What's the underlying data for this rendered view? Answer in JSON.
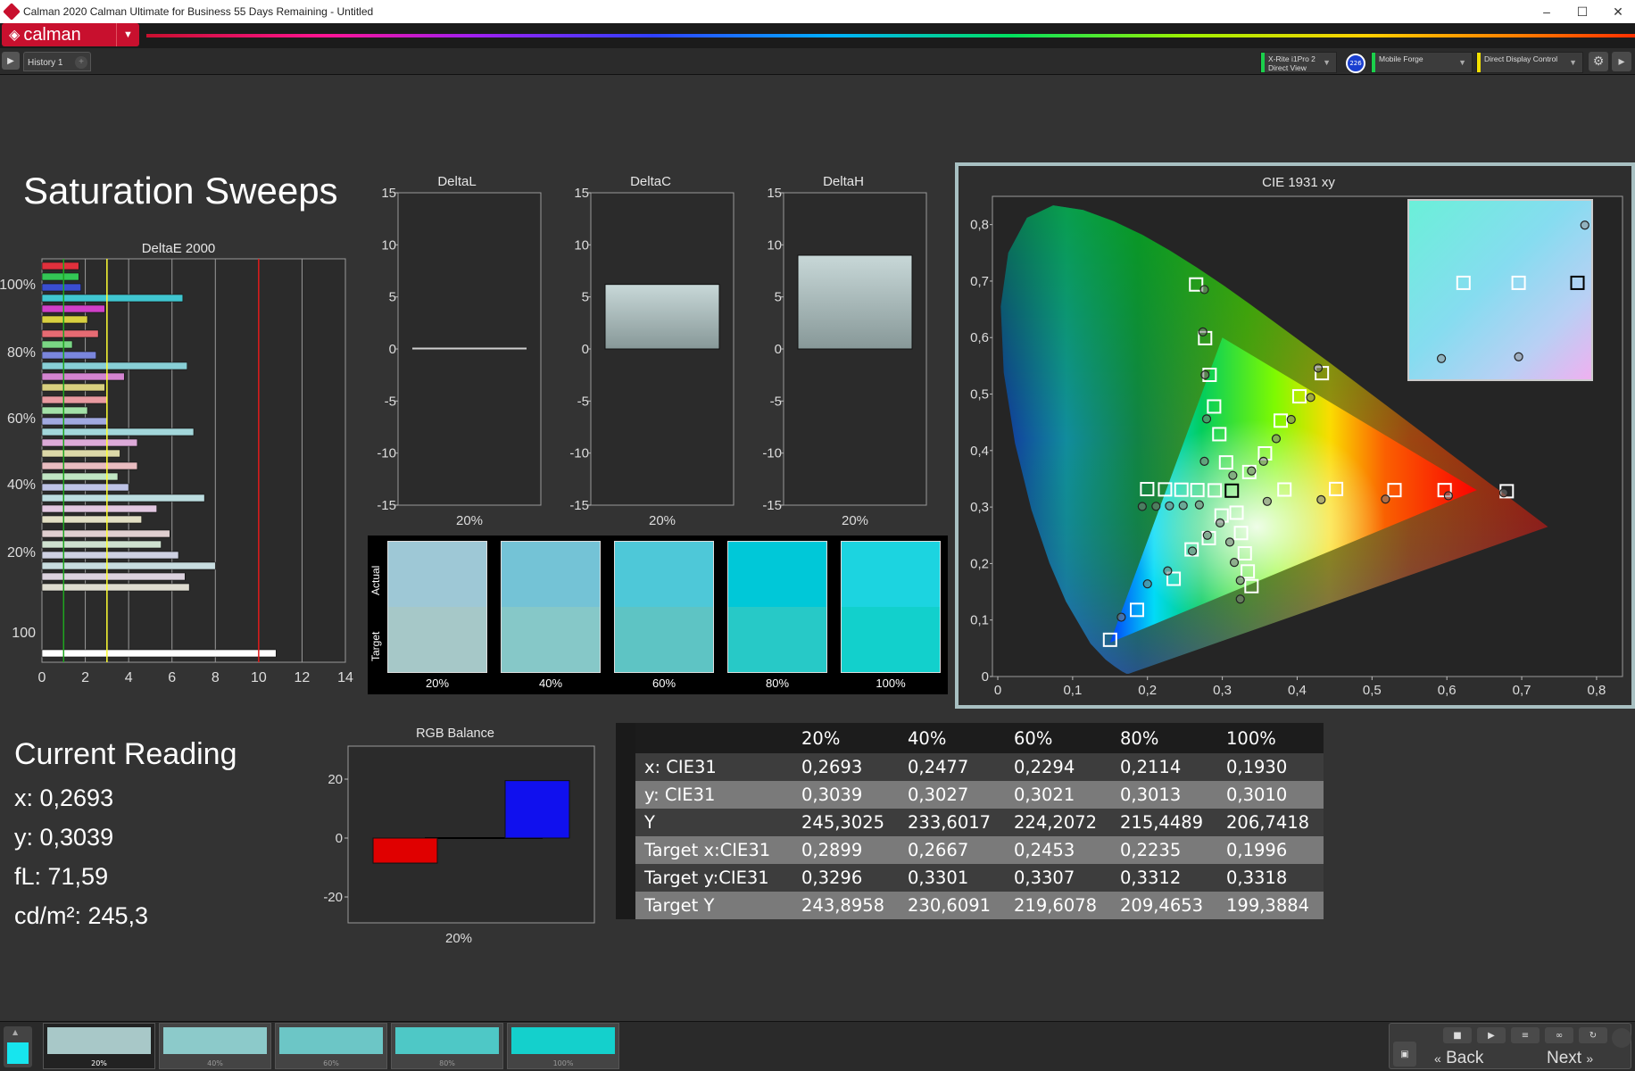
{
  "window": {
    "title": "Calman 2020 Calman Ultimate for Business 55 Days Remaining - Untitled"
  },
  "brand": {
    "logo_text": "calman"
  },
  "tabs": {
    "history": "History 1"
  },
  "devices": [
    {
      "line1": "X-Rite i1Pro 2",
      "line2": "Direct View",
      "color": "#1bd04b"
    },
    {
      "line1": "Mobile Forge",
      "line2": "",
      "color": "#1bd04b"
    },
    {
      "line1": "Direct Display Control",
      "line2": "",
      "color": "#f2e000"
    }
  ],
  "device_badge": "226",
  "page_title": "Saturation Sweeps",
  "deltae": {
    "title": "DeltaE 2000",
    "x_ticks": [
      "0",
      "2",
      "4",
      "6",
      "8",
      "10",
      "12",
      "14"
    ],
    "y_labels": [
      "100%",
      "80%",
      "60%",
      "40%",
      "20%",
      "100"
    ],
    "ref_lines": [
      {
        "x": 1,
        "color": "#1fa51f"
      },
      {
        "x": 3,
        "color": "#ffff33"
      },
      {
        "x": 10,
        "color": "#e01818"
      }
    ],
    "groups": [
      {
        "label": "100%",
        "bars": [
          1.7,
          1.7,
          1.8,
          6.5,
          2.9,
          2.1
        ],
        "colors": [
          "#e0303c",
          "#33c655",
          "#3a4ed0",
          "#40c6d0",
          "#d040c8",
          "#d8d040"
        ]
      },
      {
        "label": "80%",
        "bars": [
          2.6,
          1.4,
          2.5,
          6.7,
          3.8,
          2.9
        ],
        "colors": [
          "#e66b73",
          "#7ad684",
          "#7a86dc",
          "#88cfd6",
          "#d484d0",
          "#d8d080"
        ]
      },
      {
        "label": "60%",
        "bars": [
          3.0,
          2.1,
          3.0,
          7.0,
          4.4,
          3.6
        ],
        "colors": [
          "#e89aa0",
          "#a3e0a8",
          "#a1a9e0",
          "#a3d7db",
          "#dcaad8",
          "#dcd8a8"
        ]
      },
      {
        "label": "40%",
        "bars": [
          4.4,
          3.5,
          4.0,
          7.5,
          5.3,
          4.6
        ],
        "colors": [
          "#e9bcc0",
          "#c0e6c3",
          "#bec3e6",
          "#bcdde0",
          "#e2c7e0",
          "#e2dfc4"
        ]
      },
      {
        "label": "20%",
        "bars": [
          5.9,
          5.5,
          6.3,
          8.0,
          6.6,
          6.8
        ],
        "colors": [
          "#e0cfd0",
          "#cfe1d0",
          "#ced1e2",
          "#c8dde0",
          "#dcd2de",
          "#dedcd0"
        ]
      },
      {
        "label": "100",
        "bars": [
          10.8
        ],
        "colors": [
          "#ffffff"
        ]
      }
    ]
  },
  "delta_charts": [
    {
      "title": "DeltaL",
      "value": 0.1,
      "category": "20%"
    },
    {
      "title": "DeltaC",
      "value": 6.2,
      "category": "20%"
    },
    {
      "title": "DeltaH",
      "value": 9.0,
      "category": "20%"
    }
  ],
  "delta_y_ticks": [
    "15",
    "10",
    "5",
    "0",
    "-5",
    "-10",
    "-15"
  ],
  "swatches": {
    "actual_label": "Actual",
    "target_label": "Target",
    "items": [
      {
        "label": "20%",
        "actual": "#9ec8d6",
        "target": "#a6c8c8"
      },
      {
        "label": "40%",
        "actual": "#74c3d6",
        "target": "#86c8c8"
      },
      {
        "label": "60%",
        "actual": "#4ec8d8",
        "target": "#5ec4c4"
      },
      {
        "label": "80%",
        "actual": "#00c8d8",
        "target": "#27c9c7"
      },
      {
        "label": "100%",
        "actual": "#1cd4e0",
        "target": "#12d0cc"
      }
    ]
  },
  "cie": {
    "title": "CIE 1931 xy",
    "x_ticks": [
      "0",
      "0,1",
      "0,2",
      "0,3",
      "0,4",
      "0,5",
      "0,6",
      "0,7",
      "0,8"
    ],
    "y_ticks": [
      "0",
      "0,1",
      "0,2",
      "0,3",
      "0,4",
      "0,5",
      "0,6",
      "0,7",
      "0,8"
    ],
    "gamut": [
      [
        0.64,
        0.33
      ],
      [
        0.3,
        0.6
      ],
      [
        0.15,
        0.06
      ]
    ],
    "white": [
      0.3127,
      0.329
    ],
    "targets": [
      [
        0.2899,
        0.3296
      ],
      [
        0.2667,
        0.3301
      ],
      [
        0.2453,
        0.3307
      ],
      [
        0.2235,
        0.3312
      ],
      [
        0.1996,
        0.3318
      ],
      [
        0.383,
        0.331
      ],
      [
        0.452,
        0.332
      ],
      [
        0.53,
        0.33
      ],
      [
        0.597,
        0.33
      ],
      [
        0.68,
        0.328
      ],
      [
        0.305,
        0.379
      ],
      [
        0.296,
        0.429
      ],
      [
        0.289,
        0.478
      ],
      [
        0.283,
        0.534
      ],
      [
        0.277,
        0.599
      ],
      [
        0.265,
        0.694
      ],
      [
        0.336,
        0.362
      ],
      [
        0.357,
        0.395
      ],
      [
        0.378,
        0.453
      ],
      [
        0.403,
        0.496
      ],
      [
        0.433,
        0.537
      ],
      [
        0.319,
        0.29
      ],
      [
        0.325,
        0.254
      ],
      [
        0.33,
        0.218
      ],
      [
        0.334,
        0.186
      ],
      [
        0.339,
        0.16
      ],
      [
        0.299,
        0.285
      ],
      [
        0.282,
        0.245
      ],
      [
        0.259,
        0.225
      ],
      [
        0.235,
        0.173
      ],
      [
        0.186,
        0.118
      ],
      [
        0.15,
        0.065
      ]
    ],
    "measured": [
      [
        0.2693,
        0.3039
      ],
      [
        0.2477,
        0.3027
      ],
      [
        0.2294,
        0.3021
      ],
      [
        0.2114,
        0.3013
      ],
      [
        0.193,
        0.301
      ],
      [
        0.36,
        0.31
      ],
      [
        0.432,
        0.313
      ],
      [
        0.518,
        0.314
      ],
      [
        0.602,
        0.32
      ],
      [
        0.676,
        0.325
      ],
      [
        0.314,
        0.356
      ],
      [
        0.276,
        0.381
      ],
      [
        0.279,
        0.456
      ],
      [
        0.277,
        0.534
      ],
      [
        0.274,
        0.61
      ],
      [
        0.276,
        0.685
      ],
      [
        0.339,
        0.364
      ],
      [
        0.355,
        0.381
      ],
      [
        0.372,
        0.421
      ],
      [
        0.392,
        0.455
      ],
      [
        0.418,
        0.494
      ],
      [
        0.428,
        0.546
      ],
      [
        0.297,
        0.272
      ],
      [
        0.31,
        0.238
      ],
      [
        0.316,
        0.202
      ],
      [
        0.324,
        0.17
      ],
      [
        0.324,
        0.137
      ],
      [
        0.28,
        0.25
      ],
      [
        0.26,
        0.222
      ],
      [
        0.227,
        0.187
      ],
      [
        0.2,
        0.164
      ],
      [
        0.165,
        0.105
      ]
    ],
    "inset": {
      "squares": [
        [
          0.3,
          0.46
        ],
        [
          0.6,
          0.46
        ],
        [
          0.92,
          0.46
        ]
      ],
      "circles": [
        [
          0.18,
          0.88
        ],
        [
          0.6,
          0.87
        ],
        [
          0.96,
          0.14
        ]
      ]
    }
  },
  "rgb_balance": {
    "title": "RGB Balance",
    "y_ticks": [
      "20",
      "0",
      "-20"
    ],
    "category": "20%",
    "red": -8.5,
    "green": 0,
    "blue": 19.5
  },
  "current": {
    "title": "Current Reading",
    "x": "x: 0,2693",
    "y": "y: 0,3039",
    "fl": "fL: 71,59",
    "cdm": "cd/m²: 245,3"
  },
  "table": {
    "headers": [
      "",
      "20%",
      "40%",
      "60%",
      "80%",
      "100%"
    ],
    "rows": [
      [
        "x: CIE31",
        "0,2693",
        "0,2477",
        "0,2294",
        "0,2114",
        "0,1930"
      ],
      [
        "y: CIE31",
        "0,3039",
        "0,3027",
        "0,3021",
        "0,3013",
        "0,3010"
      ],
      [
        "Y",
        "245,3025",
        "233,6017",
        "224,2072",
        "215,4489",
        "206,7418"
      ],
      [
        "Target x:CIE31",
        "0,2899",
        "0,2667",
        "0,2453",
        "0,2235",
        "0,1996"
      ],
      [
        "Target y:CIE31",
        "0,3296",
        "0,3301",
        "0,3307",
        "0,3312",
        "0,3318"
      ],
      [
        "Target Y",
        "243,8958",
        "230,6091",
        "219,6078",
        "209,4653",
        "199,3884"
      ]
    ]
  },
  "bottom": {
    "current_color": "#17e5ee",
    "tiles": [
      {
        "label": "20%",
        "color": "#a8c8c8",
        "selected": true
      },
      {
        "label": "40%",
        "color": "#8ccaca",
        "selected": false
      },
      {
        "label": "60%",
        "color": "#6cc6c6",
        "selected": false
      },
      {
        "label": "80%",
        "color": "#4ec8c6",
        "selected": false
      },
      {
        "label": "100%",
        "color": "#14d0cc",
        "selected": false
      }
    ],
    "back_label": "Back",
    "next_label": "Next"
  }
}
